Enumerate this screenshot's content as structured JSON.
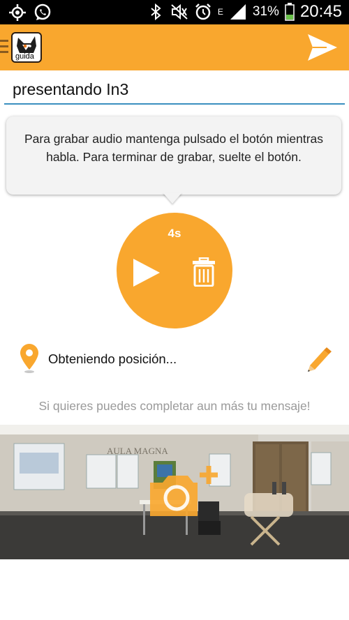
{
  "status_bar": {
    "battery_percent": "31%",
    "time": "20:45",
    "network_type": "E",
    "icons": [
      "gps-icon",
      "whatsapp-icon",
      "bluetooth-icon",
      "mute-icon",
      "alarm-icon",
      "signal-icon",
      "battery-icon"
    ]
  },
  "action_bar": {
    "logo_text": "guida",
    "send_icon": "send-icon",
    "color": "#f9a72e"
  },
  "title_field": {
    "value": "presentando In3"
  },
  "tooltip": {
    "text": "Para grabar audio mantenga pulsado el botón mientras habla. Para terminar de grabar, suelte el botón."
  },
  "recorder": {
    "duration": "4s",
    "icons": [
      "play-icon",
      "trash-icon"
    ]
  },
  "location": {
    "text": "Obteniendo posición...",
    "icons": [
      "map-pin-icon",
      "pencil-icon"
    ]
  },
  "hint": {
    "text": "Si quieres puedes completar aun más tu mensaje!"
  },
  "photo": {
    "sign_text": "AULA MAGNA",
    "icon": "add-photo-camera-icon"
  },
  "colors": {
    "accent": "#f9a72e",
    "input_underline": "#3a8fbf",
    "hint_text": "#9a9a9a"
  }
}
